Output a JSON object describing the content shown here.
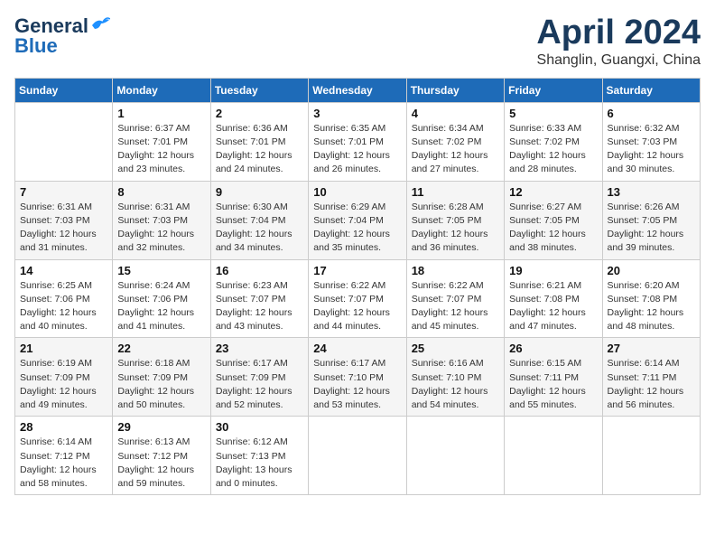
{
  "header": {
    "logo_line1": "General",
    "logo_line2": "Blue",
    "month": "April 2024",
    "location": "Shanglin, Guangxi, China"
  },
  "weekdays": [
    "Sunday",
    "Monday",
    "Tuesday",
    "Wednesday",
    "Thursday",
    "Friday",
    "Saturday"
  ],
  "weeks": [
    [
      {
        "day": "",
        "info": ""
      },
      {
        "day": "1",
        "info": "Sunrise: 6:37 AM\nSunset: 7:01 PM\nDaylight: 12 hours\nand 23 minutes."
      },
      {
        "day": "2",
        "info": "Sunrise: 6:36 AM\nSunset: 7:01 PM\nDaylight: 12 hours\nand 24 minutes."
      },
      {
        "day": "3",
        "info": "Sunrise: 6:35 AM\nSunset: 7:01 PM\nDaylight: 12 hours\nand 26 minutes."
      },
      {
        "day": "4",
        "info": "Sunrise: 6:34 AM\nSunset: 7:02 PM\nDaylight: 12 hours\nand 27 minutes."
      },
      {
        "day": "5",
        "info": "Sunrise: 6:33 AM\nSunset: 7:02 PM\nDaylight: 12 hours\nand 28 minutes."
      },
      {
        "day": "6",
        "info": "Sunrise: 6:32 AM\nSunset: 7:03 PM\nDaylight: 12 hours\nand 30 minutes."
      }
    ],
    [
      {
        "day": "7",
        "info": "Sunrise: 6:31 AM\nSunset: 7:03 PM\nDaylight: 12 hours\nand 31 minutes."
      },
      {
        "day": "8",
        "info": "Sunrise: 6:31 AM\nSunset: 7:03 PM\nDaylight: 12 hours\nand 32 minutes."
      },
      {
        "day": "9",
        "info": "Sunrise: 6:30 AM\nSunset: 7:04 PM\nDaylight: 12 hours\nand 34 minutes."
      },
      {
        "day": "10",
        "info": "Sunrise: 6:29 AM\nSunset: 7:04 PM\nDaylight: 12 hours\nand 35 minutes."
      },
      {
        "day": "11",
        "info": "Sunrise: 6:28 AM\nSunset: 7:05 PM\nDaylight: 12 hours\nand 36 minutes."
      },
      {
        "day": "12",
        "info": "Sunrise: 6:27 AM\nSunset: 7:05 PM\nDaylight: 12 hours\nand 38 minutes."
      },
      {
        "day": "13",
        "info": "Sunrise: 6:26 AM\nSunset: 7:05 PM\nDaylight: 12 hours\nand 39 minutes."
      }
    ],
    [
      {
        "day": "14",
        "info": "Sunrise: 6:25 AM\nSunset: 7:06 PM\nDaylight: 12 hours\nand 40 minutes."
      },
      {
        "day": "15",
        "info": "Sunrise: 6:24 AM\nSunset: 7:06 PM\nDaylight: 12 hours\nand 41 minutes."
      },
      {
        "day": "16",
        "info": "Sunrise: 6:23 AM\nSunset: 7:07 PM\nDaylight: 12 hours\nand 43 minutes."
      },
      {
        "day": "17",
        "info": "Sunrise: 6:22 AM\nSunset: 7:07 PM\nDaylight: 12 hours\nand 44 minutes."
      },
      {
        "day": "18",
        "info": "Sunrise: 6:22 AM\nSunset: 7:07 PM\nDaylight: 12 hours\nand 45 minutes."
      },
      {
        "day": "19",
        "info": "Sunrise: 6:21 AM\nSunset: 7:08 PM\nDaylight: 12 hours\nand 47 minutes."
      },
      {
        "day": "20",
        "info": "Sunrise: 6:20 AM\nSunset: 7:08 PM\nDaylight: 12 hours\nand 48 minutes."
      }
    ],
    [
      {
        "day": "21",
        "info": "Sunrise: 6:19 AM\nSunset: 7:09 PM\nDaylight: 12 hours\nand 49 minutes."
      },
      {
        "day": "22",
        "info": "Sunrise: 6:18 AM\nSunset: 7:09 PM\nDaylight: 12 hours\nand 50 minutes."
      },
      {
        "day": "23",
        "info": "Sunrise: 6:17 AM\nSunset: 7:09 PM\nDaylight: 12 hours\nand 52 minutes."
      },
      {
        "day": "24",
        "info": "Sunrise: 6:17 AM\nSunset: 7:10 PM\nDaylight: 12 hours\nand 53 minutes."
      },
      {
        "day": "25",
        "info": "Sunrise: 6:16 AM\nSunset: 7:10 PM\nDaylight: 12 hours\nand 54 minutes."
      },
      {
        "day": "26",
        "info": "Sunrise: 6:15 AM\nSunset: 7:11 PM\nDaylight: 12 hours\nand 55 minutes."
      },
      {
        "day": "27",
        "info": "Sunrise: 6:14 AM\nSunset: 7:11 PM\nDaylight: 12 hours\nand 56 minutes."
      }
    ],
    [
      {
        "day": "28",
        "info": "Sunrise: 6:14 AM\nSunset: 7:12 PM\nDaylight: 12 hours\nand 58 minutes."
      },
      {
        "day": "29",
        "info": "Sunrise: 6:13 AM\nSunset: 7:12 PM\nDaylight: 12 hours\nand 59 minutes."
      },
      {
        "day": "30",
        "info": "Sunrise: 6:12 AM\nSunset: 7:13 PM\nDaylight: 13 hours\nand 0 minutes."
      },
      {
        "day": "",
        "info": ""
      },
      {
        "day": "",
        "info": ""
      },
      {
        "day": "",
        "info": ""
      },
      {
        "day": "",
        "info": ""
      }
    ]
  ]
}
